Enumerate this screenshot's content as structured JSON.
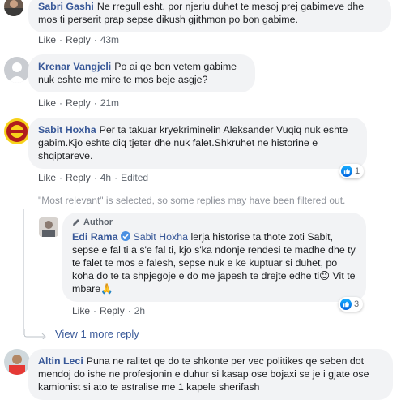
{
  "comments": [
    {
      "author": "Sabri Gashi",
      "text": "Ne rregull esht, por njeriu duhet te mesoj prej gabimeve dhe mos ti perserit prap sepse dikush gjithmon po bon gabime.",
      "like": "Like",
      "reply": "Reply",
      "time": "43m"
    },
    {
      "author": "Krenar Vangjeli",
      "text": "Po ai qe ben vetem gabime nuk eshte me mire te mos beje asgje?",
      "like": "Like",
      "reply": "Reply",
      "time": "21m"
    },
    {
      "author": "Sabit Hoxha",
      "text": "Per ta takuar kryekriminelin Aleksander Vuqiq nuk eshte gabim.Kjo eshte diq tjeter dhe nuk falet.Shkruhet ne historine e shqiptareve.",
      "like": "Like",
      "reply": "Reply",
      "time": "4h",
      "edited": "Edited",
      "reactions": "1"
    }
  ],
  "filter_note": "\"Most relevant\" is selected, so some replies may have been filtered out.",
  "reply": {
    "badge": "Author",
    "author": "Edi Rama",
    "mention": "Sabit Hoxha",
    "text": "lerja historise ta thote zoti Sabit, sepse e fal ti a s'e fal ti, kjo s'ka ndonje rendesi te madhe dhe ty te falet te mos e falesh, sepse nuk e ke kuptuar si duhet, po koha do te ta shpjegoje e do me japesh te drejte edhe ti😉 Vit te mbare🙏",
    "like": "Like",
    "reply": "Reply",
    "time": "2h",
    "reactions": "3"
  },
  "more_replies": "View 1 more reply",
  "last_comment": {
    "author": "Altin Leci",
    "text": "Puna ne ralitet qe do te shkonte per vec politikes qe seben dot mendoj do ishe ne profesjonin e duhur si kasap ose bojaxi se je i gjate ose kamionist si ato te astralise me 1 kapele sherifash"
  }
}
